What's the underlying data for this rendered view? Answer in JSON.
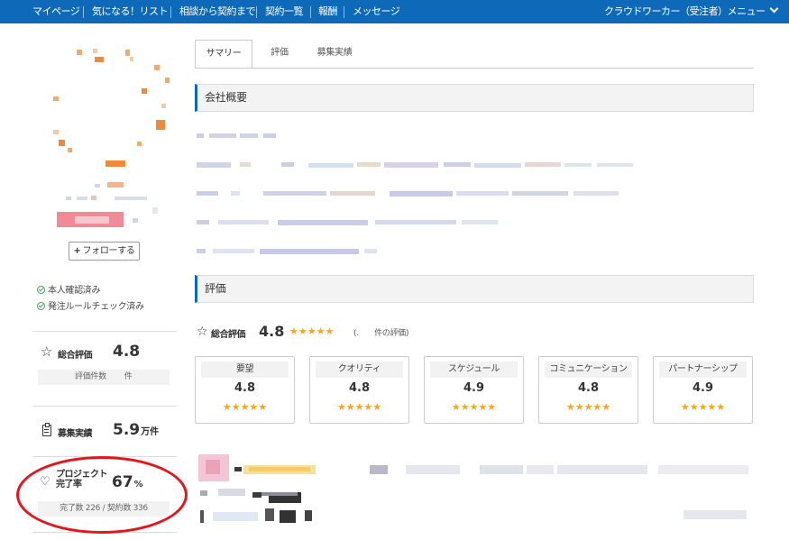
{
  "nav": {
    "items": [
      "マイページ",
      "気になる！リスト",
      "相談から契約まで",
      "契約一覧",
      "報酬",
      "メッセージ"
    ],
    "role_menu": "クラウドワーカー（受注者）メニュー"
  },
  "sidebar": {
    "follow_label": "フォローする",
    "verifications": [
      "本人確認済み",
      "発注ルールチェック済み"
    ],
    "rating": {
      "label": "総合評価",
      "value": "4.8",
      "count_label": "評価件数",
      "count_suffix": "件"
    },
    "recruit": {
      "label": "募集実績",
      "value": "5.9",
      "unit": "万件"
    },
    "completion": {
      "label_line1": "プロジェクト",
      "label_line2": "完了率",
      "value": "67",
      "unit": "%",
      "detail": "完了数 226 / 契約数 336"
    }
  },
  "tabs": [
    "サマリー",
    "評価",
    "募集実績"
  ],
  "sections": {
    "company": "会社概要",
    "evaluation": "評価"
  },
  "evaluation": {
    "overall_label": "総合評価",
    "overall_value": "4.8",
    "overall_stars": "★★★★★",
    "count_text": "(.　　件の評価)",
    "cards": [
      {
        "name": "要望",
        "value": "4.8",
        "stars": "★★★★★"
      },
      {
        "name": "クオリティ",
        "value": "4.8",
        "stars": "★★★★★"
      },
      {
        "name": "スケジュール",
        "value": "4.9",
        "stars": "★★★★★"
      },
      {
        "name": "コミュニケーション",
        "value": "4.8",
        "stars": "★★★★★"
      },
      {
        "name": "パートナーシップ",
        "value": "4.9",
        "stars": "★★★★★"
      }
    ]
  },
  "colors": {
    "nav_bg": "#0e6ab8",
    "accent": "#0e6ab8",
    "star": "#f5a623",
    "highlight": "#e8141c"
  }
}
